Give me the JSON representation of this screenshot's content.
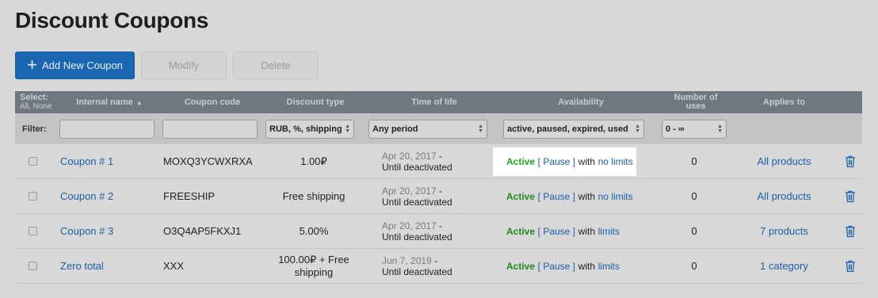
{
  "page": {
    "title": "Discount Coupons"
  },
  "toolbar": {
    "add_label": "Add New Coupon",
    "modify_label": "Modify",
    "delete_label": "Delete"
  },
  "columns": {
    "select": "Select:",
    "select_sub": "All, None",
    "internal_name": "Internal name",
    "coupon_code": "Coupon code",
    "discount_type": "Discount type",
    "time_of_life": "Time of life",
    "availability": "Availability",
    "uses_line1": "Number of",
    "uses_line2": "uses",
    "applies_to": "Applies to"
  },
  "filters": {
    "label": "Filter:",
    "discount_type": "RUB, %, shipping",
    "period": "Any period",
    "availability": "active, paused, expired, used",
    "uses": "0 - ∞"
  },
  "rows": [
    {
      "name": "Coupon # 1",
      "code": "MOXQ3YCWXRXA",
      "discount": "1.00₽",
      "discount2": "",
      "date": "Apr 20, 2017",
      "until": "Until deactivated",
      "status": "Active",
      "pause": "[ Pause ]",
      "with": "with",
      "limit": "no limits",
      "uses": "0",
      "applies": "All products"
    },
    {
      "name": "Coupon # 2",
      "code": "FREESHIP",
      "discount": "Free shipping",
      "discount2": "",
      "date": "Apr 20, 2017",
      "until": "Until deactivated",
      "status": "Active",
      "pause": "[ Pause ]",
      "with": "with",
      "limit": "no limits",
      "uses": "0",
      "applies": "All products"
    },
    {
      "name": "Coupon # 3",
      "code": "O3Q4AP5FKXJ1",
      "discount": "5.00%",
      "discount2": "",
      "date": "Apr 20, 2017",
      "until": "Until deactivated",
      "status": "Active",
      "pause": "[ Pause ]",
      "with": "with",
      "limit": "limits",
      "uses": "0",
      "applies": "7 products"
    },
    {
      "name": "Zero total",
      "code": "XXX",
      "discount": "100.00₽ + Free",
      "discount2": "shipping",
      "date": "Jun 7, 2019",
      "until": "Until deactivated",
      "status": "Active",
      "pause": "[ Pause ]",
      "with": "with",
      "limit": "limits",
      "uses": "0",
      "applies": "1 category"
    }
  ],
  "icons": {
    "add": "plus-icon",
    "sort": "sort-asc-icon",
    "delete": "trash-icon",
    "select": "select-arrows-icon"
  },
  "colors": {
    "primary": "#1a66b0",
    "active": "#1e8a1e",
    "link": "#1a5fa8"
  }
}
